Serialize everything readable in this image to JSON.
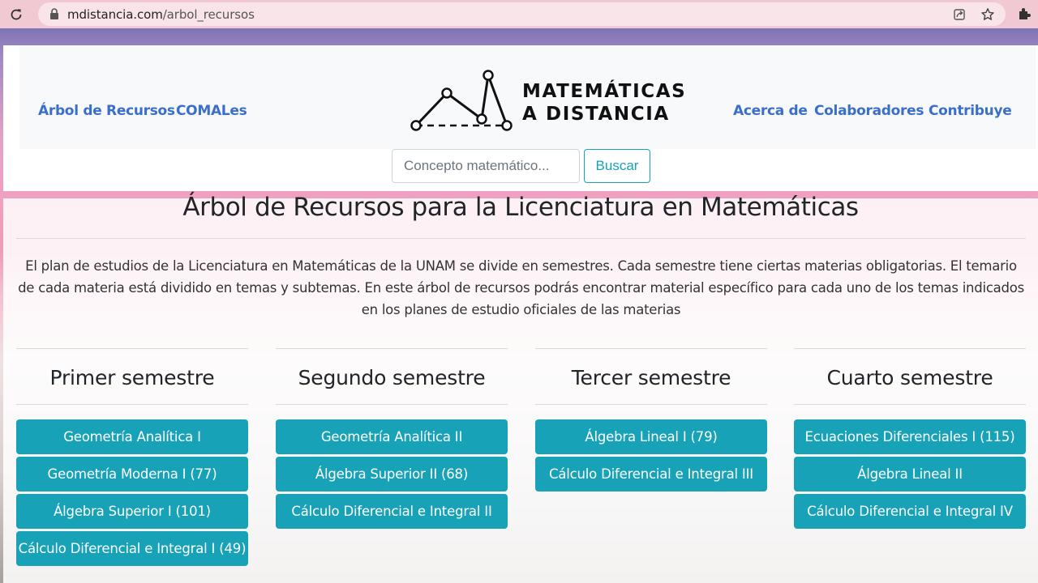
{
  "browser": {
    "url_host": "mdistancia.com",
    "url_path": "/arbol_recursos"
  },
  "nav": {
    "left": [
      "Árbol de Recursos",
      "COMALes"
    ],
    "right": [
      "Acerca de",
      "Colaboradores",
      "Contribuye"
    ]
  },
  "logo": {
    "line1": "MATEMÁTICAS",
    "line2": "A DISTANCIA"
  },
  "search": {
    "placeholder": "Concepto matemático...",
    "button": "Buscar"
  },
  "main": {
    "title": "Árbol de Recursos para la Licenciatura en Matemáticas",
    "intro": "El plan de estudios de la Licenciatura en Matemáticas de la UNAM se divide en semestres. Cada semestre tiene ciertas materias obligatorias. El temario de cada materia está dividido en temas y subtemas. En este árbol de recursos podrás encontrar material específico para cada uno de los temas indicados en los planes de estudio oficiales de las materias"
  },
  "semesters": [
    {
      "title": "Primer semestre",
      "subjects": [
        "Geometría Analítica I",
        "Geometría Moderna I (77)",
        "Álgebra Superior I (101)",
        "Cálculo Diferencial e Integral I (49)"
      ]
    },
    {
      "title": "Segundo semestre",
      "subjects": [
        "Geometría Analítica II",
        "Álgebra Superior II (68)",
        "Cálculo Diferencial e Integral II"
      ]
    },
    {
      "title": "Tercer semestre",
      "subjects": [
        "Álgebra Lineal I (79)",
        "Cálculo Diferencial e Integral III"
      ]
    },
    {
      "title": "Cuarto semestre",
      "subjects": [
        "Ecuaciones Diferenciales I (115)",
        "Álgebra Lineal II",
        "Cálculo Diferencial e Integral IV"
      ]
    }
  ],
  "colors": {
    "accent": "#17a2b8",
    "link": "#3a6fc9"
  },
  "icons": [
    "reload-icon",
    "lock-icon",
    "share-icon",
    "star-icon",
    "extensions-icon"
  ]
}
